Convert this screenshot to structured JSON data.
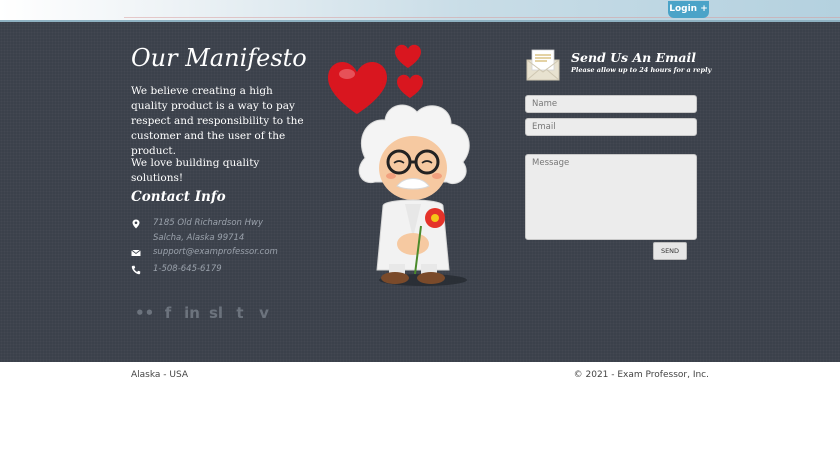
{
  "header": {
    "login_label": "Login +"
  },
  "manifesto": {
    "title": "Our Manifesto",
    "paragraph1": "We believe creating a high quality product is a way to pay respect and responsibility to the customer and the user of the product.",
    "paragraph2": "We love building quality solutions!"
  },
  "contact": {
    "title": "Contact Info",
    "address_line1": "7185 Old Richardson Hwy",
    "address_line2": "Salcha, Alaska 99714",
    "email": "support@examprofessor.com",
    "phone": "1-508-645-6179",
    "icons": [
      "map-pin-icon",
      "envelope-icon",
      "phone-icon"
    ]
  },
  "social": {
    "links": [
      {
        "name": "flickr",
        "glyph": "••"
      },
      {
        "name": "facebook",
        "glyph": "f"
      },
      {
        "name": "linkedin",
        "glyph": "in"
      },
      {
        "name": "slideshare",
        "glyph": "sl"
      },
      {
        "name": "tumblr",
        "glyph": "t"
      },
      {
        "name": "vimeo",
        "glyph": "v"
      }
    ]
  },
  "email_form": {
    "title": "Send Us An Email",
    "subtitle": "Please allow up to 24 hours for a reply",
    "name_placeholder": "Name",
    "email_placeholder": "Email",
    "message_placeholder": "Message",
    "send_label": "SEND"
  },
  "footer": {
    "location": "Alaska - USA",
    "copyright": "© 2021 - Exam Professor, Inc."
  },
  "colors": {
    "background": "#3b414b",
    "login_button": "#4aa3c8",
    "heart": "#d9161f"
  }
}
